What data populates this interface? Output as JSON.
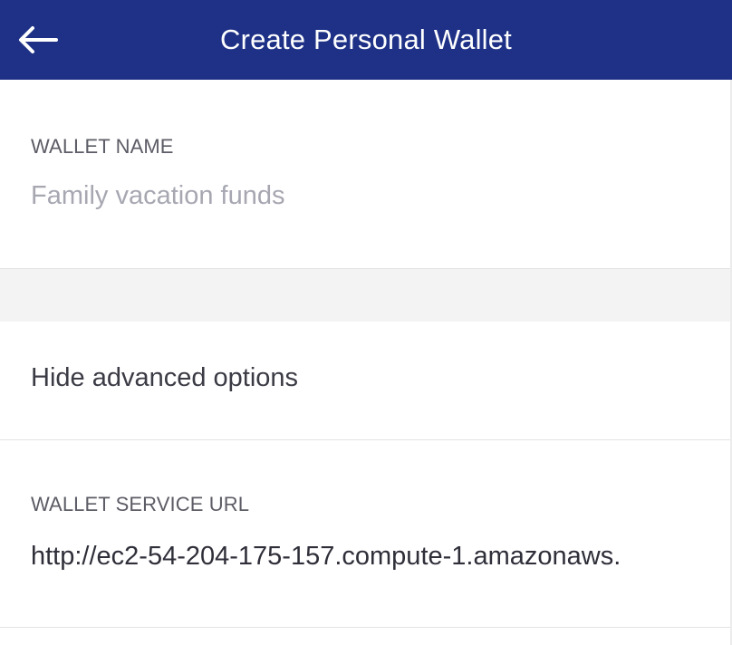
{
  "header": {
    "title": "Create Personal Wallet",
    "back_icon": "arrow-left-icon"
  },
  "form": {
    "wallet_name": {
      "label": "WALLET NAME",
      "value": "",
      "placeholder": "Family vacation funds"
    },
    "advanced_toggle": {
      "label": "Hide advanced options"
    },
    "wallet_service_url": {
      "label": "WALLET SERVICE URL",
      "value": "http://ec2-54-204-175-157.compute-1.amazonaws."
    }
  },
  "colors": {
    "header_bg": "#1e3186",
    "header_text": "#ffffff",
    "label": "#5c5c66",
    "placeholder": "#a7a7b2",
    "body_text": "#3b3b45",
    "divider_band": "#f3f3f3"
  }
}
